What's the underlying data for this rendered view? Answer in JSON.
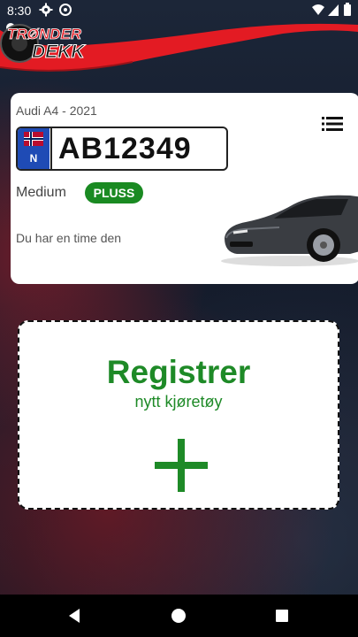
{
  "status_bar": {
    "time": "8:30",
    "icons": [
      "gear-icon",
      "at-icon",
      "wifi-icon",
      "signal-icon",
      "battery-icon"
    ]
  },
  "header": {
    "brand_top": "TRØNDER",
    "brand_bottom": "DEKK",
    "icons": [
      "user-icon"
    ],
    "accent_color": "#e31b23"
  },
  "vehicle": {
    "model": "Audi A4 - 2021",
    "plate_country": "N",
    "plate_number": "AB12349",
    "tier_label": "Medium",
    "tier_badge": "PLUSS",
    "appointment_text": "Du har en time den",
    "menu_icon": "list-icon",
    "badge_color": "#1a8a22"
  },
  "register": {
    "title": "Registrer",
    "subtitle": "nytt kjøretøy",
    "icon": "plus-icon",
    "color": "#1e8a27"
  },
  "nav_bar": {
    "buttons": [
      "back-icon",
      "home-icon",
      "recents-icon"
    ]
  }
}
